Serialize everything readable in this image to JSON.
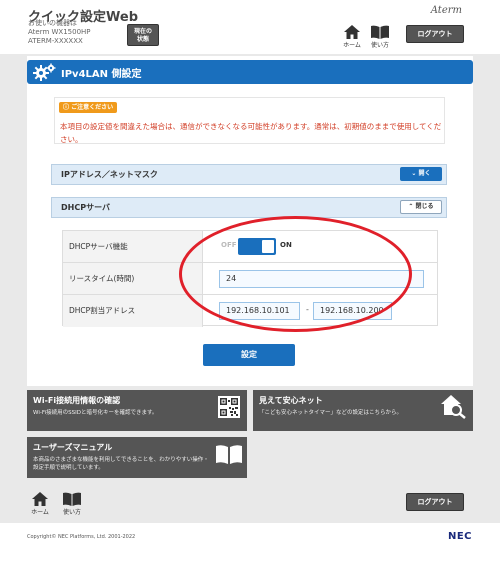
{
  "header": {
    "app_title": "クイック設定Web",
    "device_label": "お使いの機器は",
    "model": "Aterm WX1500HP",
    "device_id": "ATERM-XXXXXX",
    "status_button": [
      "現在の",
      "状態"
    ],
    "brand": "Aterm",
    "home_label": "ホーム",
    "help_label": "使い方",
    "logout_label": "ログアウト"
  },
  "page": {
    "title": "IPv4LAN 側設定"
  },
  "notice": {
    "badge": "ご注意ください",
    "text": "本項目の設定値を間違えた場合は、通信ができなくなる可能性があります。通常は、初期値のままで使用してください。"
  },
  "sections": {
    "ip_mask": {
      "title": "IPアドレス／ネットマスク",
      "toggle_label": "開く"
    },
    "dhcp": {
      "title": "DHCPサーバ",
      "toggle_label": "閉じる"
    }
  },
  "dhcp_form": {
    "function_label": "DHCPサーバ機能",
    "off_label": "OFF",
    "on_label": "ON",
    "lease_label": "リースタイム(時間)",
    "lease_value": "24",
    "range_label": "DHCP割当アドレス",
    "range_start": "192.168.10.101",
    "range_sep": "-",
    "range_end": "192.168.10.200"
  },
  "set_button": "設定",
  "tiles": [
    {
      "title": "Wi-Fi接続用情報の確認",
      "desc": "Wi-Fi接続用のSSIDと暗号化キーを確認できます。"
    },
    {
      "title": "見えて安心ネット",
      "desc": "「こども安心ネットタイマー」などの設定はこちらから。"
    },
    {
      "title": "ユーザーズマニュアル",
      "desc": "本商品のさまざまな機能を利用してできることを、わかりやすい操作・設定手順で説明しています。"
    }
  ],
  "footer": {
    "home_label": "ホーム",
    "help_label": "使い方",
    "logout_label": "ログアウト",
    "copyright": "Copyright© NEC Platforms, Ltd. 2001-2022",
    "logo": "NEC"
  },
  "colors": {
    "accent": "#1a6fbd",
    "warning": "#f09a1b",
    "error_text": "#d23d25",
    "highlight_oval": "#e0202a",
    "tile_bg": "#555555"
  }
}
